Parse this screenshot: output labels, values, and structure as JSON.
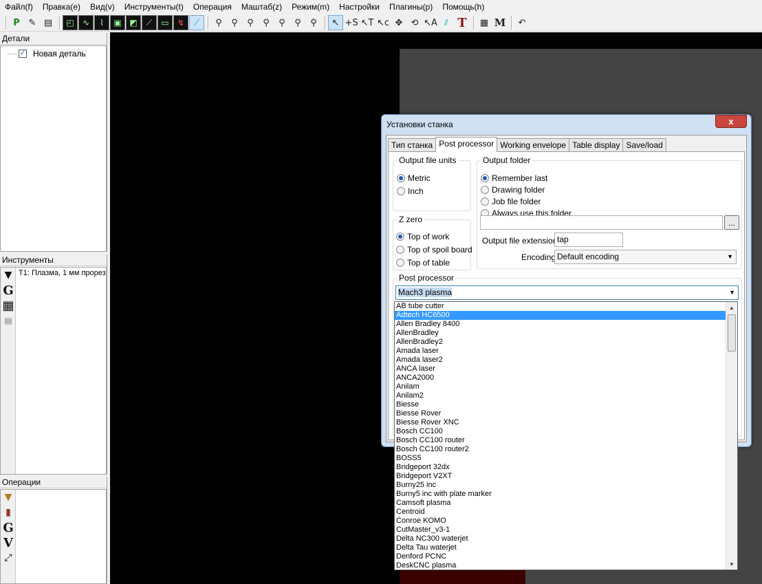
{
  "menu": [
    "Файл(f)",
    "Правка(e)",
    "Вид(v)",
    "Инструменты(t)",
    "Операция",
    "Маштаб(z)",
    "Режим(m)",
    "Настройки",
    "Плагины(p)",
    "Помощь(h)"
  ],
  "parts_panel": {
    "title": "Детали",
    "item": "Новая деталь",
    "checked": true
  },
  "tools_panel": {
    "title": "Инструменты",
    "item": "T1: Плазма, 1 мм прорез"
  },
  "operations_panel": {
    "title": "Операции"
  },
  "dialog": {
    "title": "Установки станка",
    "close_label": "x",
    "tabs": [
      "Тип станка",
      "Post processor",
      "Working envelope",
      "Table display",
      "Save/load"
    ],
    "active_tab": "Post processor",
    "output_units": {
      "label": "Output file units",
      "options": [
        "Metric",
        "Inch"
      ],
      "selected": "Metric"
    },
    "z_zero": {
      "label": "Z zero",
      "options": [
        "Top of work",
        "Top of spoil board",
        "Top of table"
      ],
      "selected": "Top of work"
    },
    "output_folder": {
      "label": "Output folder",
      "options": [
        "Remember last",
        "Drawing folder",
        "Job file folder",
        "Always use this folder"
      ],
      "selected": "Remember last",
      "path_value": "",
      "browse_label": "...",
      "extension_label": "Output file extension",
      "extension_value": "tap",
      "encoding_label": "Encoding",
      "encoding_value": "Default encoding"
    },
    "post_processor": {
      "label": "Post processor",
      "selected": "Mach3 plasma"
    }
  },
  "dropdown": {
    "highlighted": "Adtech HC6500",
    "items": [
      "AB tube cutter",
      "Adtech HC6500",
      "Allen Bradley 8400",
      "AllenBradley",
      "AllenBradley2",
      "Amada laser",
      "Amada laser2",
      "ANCA laser",
      "ANCA2000",
      "Anilam",
      "Anilam2",
      "Biesse",
      "Biesse Rover",
      "Biesse Rover XNC",
      "Bosch CC100",
      "Bosch CC100 router",
      "Bosch CC100 router2",
      "BOSS5",
      "Bridgeport 32dx",
      "Bridgeport V2XT",
      "Burny25 inc",
      "Burny5 inc with plate marker",
      "Camsoft plasma",
      "Centroid",
      "Conroe KOMO",
      "CutMaster_v3-1",
      "Delta NC300 waterjet",
      "Delta Tau waterjet",
      "Denford PCNC",
      "DeskCNC plasma"
    ]
  },
  "colors": {
    "canvas": "#000000",
    "sheet": "#444444",
    "selection": "#3399ff",
    "close_button": "#c9473d"
  }
}
